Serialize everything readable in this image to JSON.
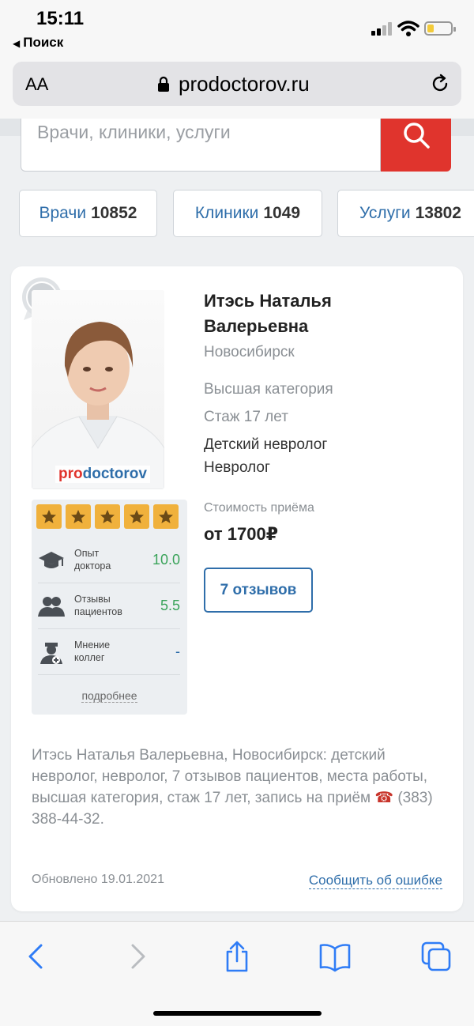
{
  "status": {
    "time": "15:11",
    "back_label": "Поиск"
  },
  "address": {
    "aa": "AA",
    "domain": "prodoctorov.ru"
  },
  "search": {
    "placeholder": "Врачи, клиники, услуги"
  },
  "stats": [
    {
      "label": "Врачи",
      "count": "10852"
    },
    {
      "label": "Клиники",
      "count": "1049"
    },
    {
      "label": "Услуги",
      "count": "13802"
    }
  ],
  "doctor": {
    "name": "Итэсь Наталья Валерьевна",
    "city": "Новосибирск",
    "category": "Высшая категория",
    "experience": "Стаж 17 лет",
    "specialties": [
      "Детский невролог",
      "Невролог"
    ],
    "price_label": "Стоимость приёма",
    "price": "от 1700₽",
    "reviews_button": "7 отзывов",
    "photo_logo_pro": "pro",
    "photo_logo_doc": "doctorov"
  },
  "rating": {
    "stars": 5,
    "rows": [
      {
        "label": "Опыт доктора",
        "value": "10.0",
        "icon": "graduation-cap-icon"
      },
      {
        "label": "Отзывы пациентов",
        "value": "5.5",
        "icon": "patients-icon"
      },
      {
        "label": "Мнение коллег",
        "value": "-",
        "icon": "doctor-icon"
      }
    ],
    "more": "подробнее"
  },
  "description": {
    "text": "Итэсь Наталья Валерьевна, Новосибирск: детский невролог, невролог, 7 отзывов пациентов, места работы, высшая категория, стаж 17 лет, запись на приём",
    "phone": "(383) 388-44-32."
  },
  "footer": {
    "updated": "Обновлено 19.01.2021",
    "report": "Сообщить об ошибке"
  },
  "colors": {
    "accent": "#2f6eaa",
    "search_button": "#e0342d",
    "star": "#f0b13c",
    "score": "#3aa35a"
  },
  "battery_level": 0.3
}
